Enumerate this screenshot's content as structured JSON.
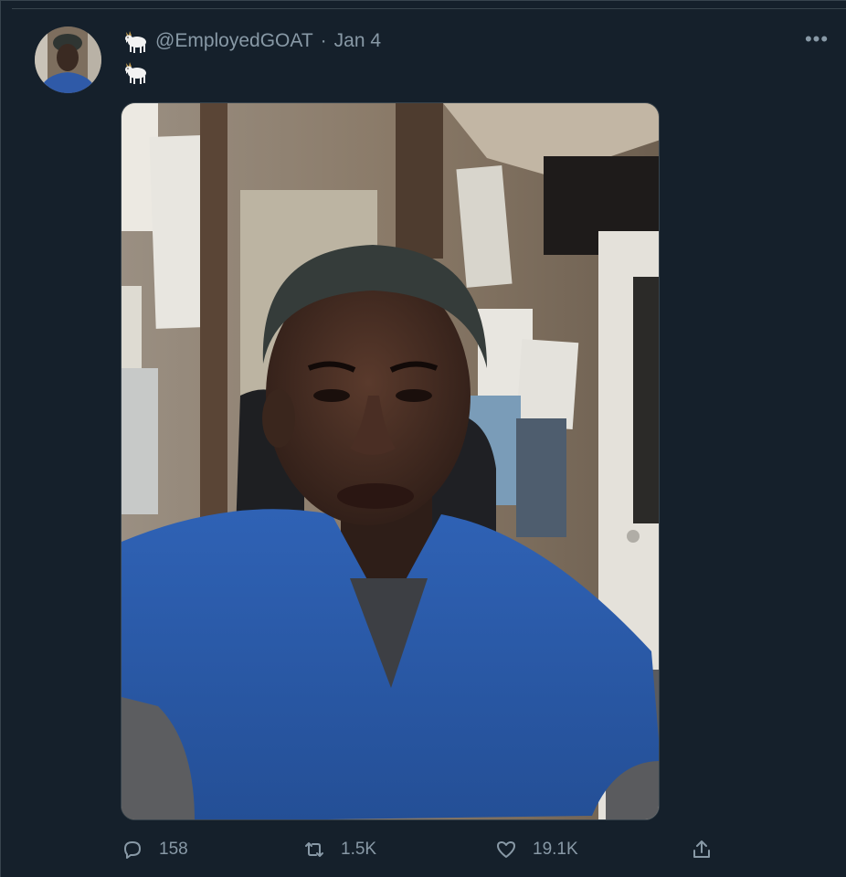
{
  "tweet": {
    "handle": "@EmployedGOAT",
    "separator": "·",
    "date": "Jan 4",
    "more_label": "•••",
    "emoji_name": "goat-icon",
    "media_name": "selfie-photo"
  },
  "actions": {
    "reply_count": "158",
    "retweet_count": "1.5K",
    "like_count": "19.1K"
  },
  "colors": {
    "background": "#15202b",
    "secondary_text": "#8899a6",
    "border": "#38444d"
  }
}
